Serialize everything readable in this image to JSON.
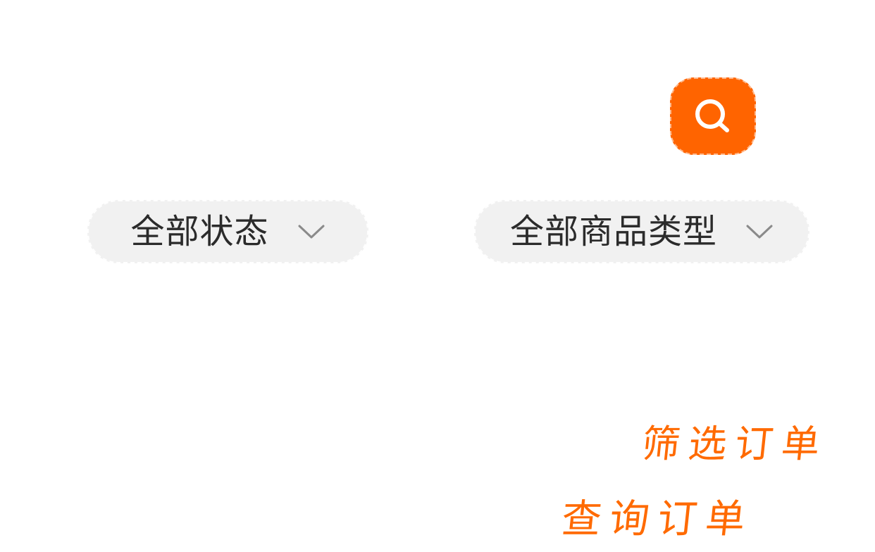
{
  "colors": {
    "accent": "#ff6400",
    "dropdown_bg": "#f1f1f1",
    "text": "#2b2b2b",
    "chevron": "#8a8a8a",
    "annotation": "#ff6a00"
  },
  "search": {
    "icon": "search-icon"
  },
  "filters": {
    "status": {
      "label": "全部状态",
      "icon": "chevron-down-icon"
    },
    "product_type": {
      "label": "全部商品类型",
      "icon": "chevron-down-icon"
    }
  },
  "annotations": {
    "filter_orders": "筛选订单",
    "query_orders": "查询订单"
  }
}
